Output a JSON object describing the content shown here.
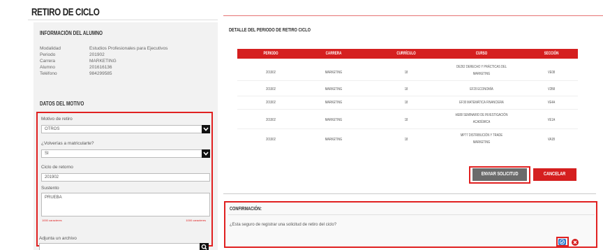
{
  "page": {
    "title": "RETIRO DE CICLO"
  },
  "student_info": {
    "heading": "INFORMACIÓN DEL ALUMNO",
    "rows": [
      {
        "label": "Modalidad",
        "value": "Estudios Profesionales para Ejecutivos"
      },
      {
        "label": "Periodo",
        "value": "201902"
      },
      {
        "label": "Carrera",
        "value": "MARKETING"
      },
      {
        "label": "Alumno",
        "value": "201616136"
      },
      {
        "label": "Teléfono",
        "value": "984299585"
      }
    ]
  },
  "motive": {
    "heading": "DATOS DEL MOTIVO",
    "reason_label": "Motivo de retiro",
    "reason_value": "OTROS",
    "return_label": "¿Volverías a matricularte?",
    "return_value": "SI",
    "cycle_label": "Ciclo de retorno",
    "cycle_value": "201902",
    "support_label": "Sustento",
    "support_value": "PRUEBA",
    "counter_left": "1000 caracteres",
    "counter_right": "1000 caracteres",
    "attach_label": "Adjunta un archivo",
    "attach_value": ""
  },
  "detail": {
    "heading": "DETALLE DEL PERIODO DE RETIRO CICLO",
    "columns": [
      "PERIODO",
      "CARRERA",
      "CURRÍCULO",
      "CURSO",
      "SECCIÓN"
    ],
    "rows": [
      {
        "periodo": "201902",
        "carrera": "MARKETING",
        "curriculo": "18",
        "curso_l1": "DE262 DERECHO Y PRÁCTICAS DEL",
        "curso_l2": "MARKETING",
        "seccion": "VE08"
      },
      {
        "periodo": "201902",
        "carrera": "MARKETING",
        "curriculo": "18",
        "curso_l1": "EF20 ECONOMÍA",
        "curso_l2": "",
        "seccion": "V2B8"
      },
      {
        "periodo": "201902",
        "carrera": "MARKETING",
        "curriculo": "18",
        "curso_l1": "EF30 MATEMÁTICA FINANCIERA",
        "curso_l2": "",
        "seccion": "VE4A"
      },
      {
        "periodo": "201902",
        "carrera": "MARKETING",
        "curriculo": "18",
        "curso_l1": "HE88 SEMINARIO DE INVESTIGACIÓN",
        "curso_l2": "ACADÉMICA",
        "seccion": "VE1A"
      },
      {
        "periodo": "201902",
        "carrera": "MARKETING",
        "curriculo": "18",
        "curso_l1": "MP77 DISTRIBUCIÓN Y TRADE",
        "curso_l2": "MARKETING",
        "seccion": "VA1B"
      }
    ]
  },
  "actions": {
    "send_label": "ENVIAR SOLICITUD",
    "cancel_label": "CANCELAR"
  },
  "confirm": {
    "heading": "CONFIRMACIÓN:",
    "message": "¿Esta seguro de registrar una solicitud de retiro del ciclo?"
  },
  "colors": {
    "accent": "#d51f1f",
    "highlight": "#e02020",
    "primary_button": "#2a77c9"
  }
}
